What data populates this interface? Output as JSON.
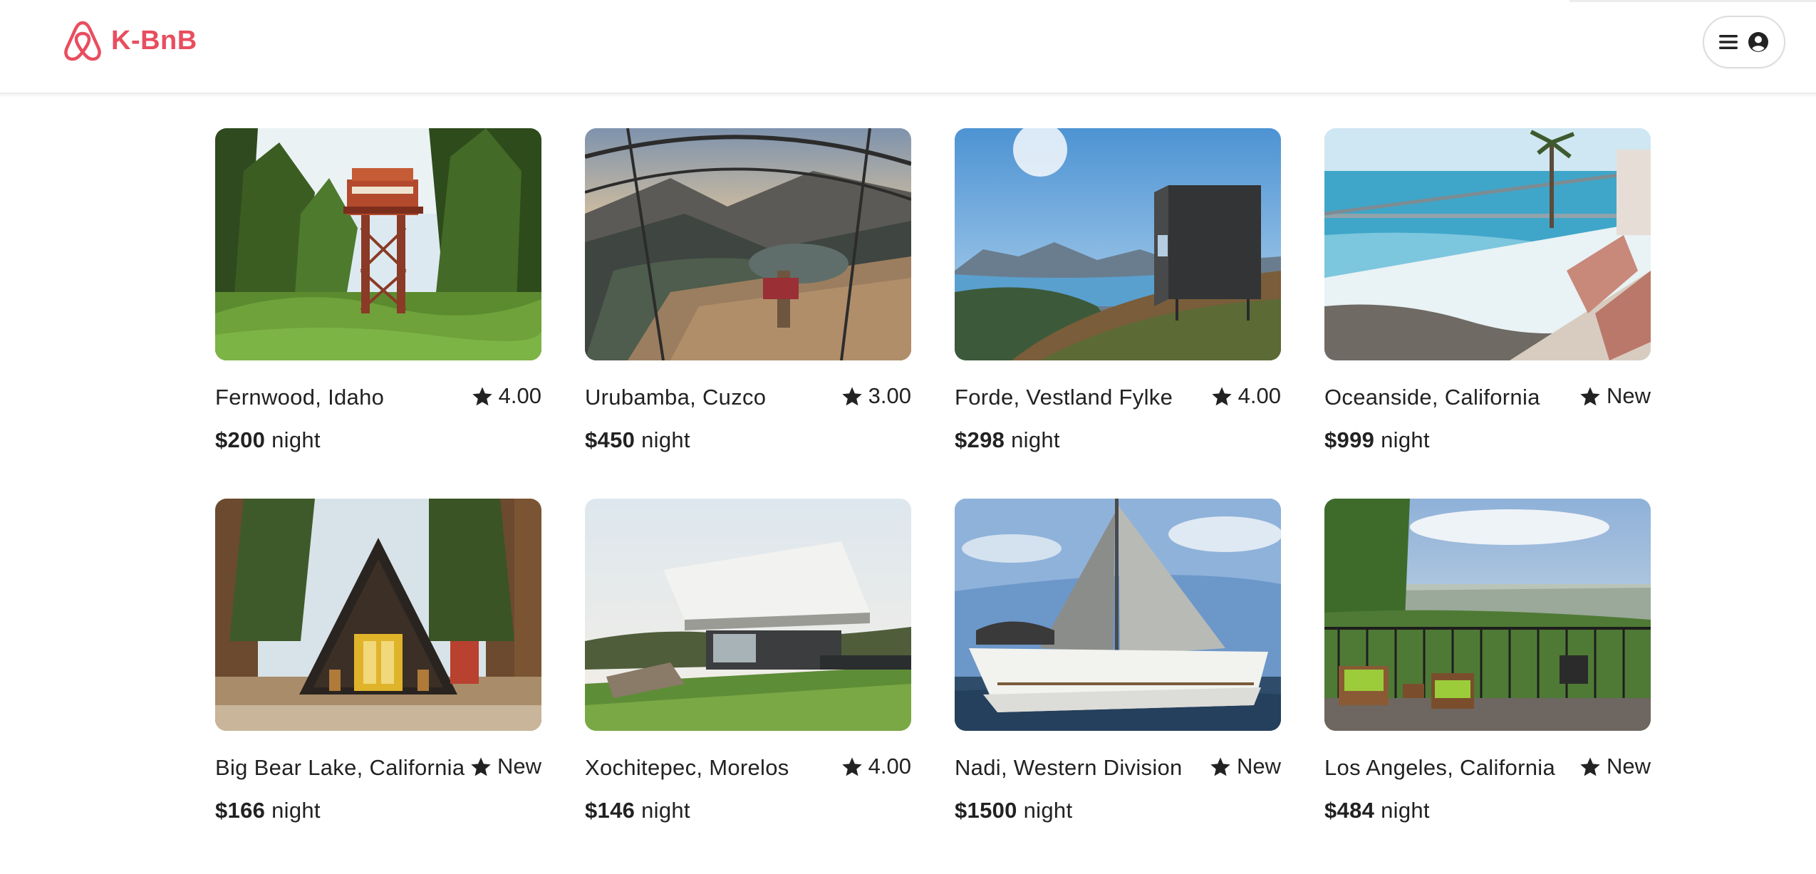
{
  "brand": {
    "name": "K-BnB",
    "color": "#e84e5f",
    "logo_icon": "airbnb-belo-icon"
  },
  "header": {
    "menu_icon": "hamburger-menu-icon",
    "avatar_icon": "user-circle-icon"
  },
  "price_suffix": "night",
  "rating_icon": "star-icon",
  "listings": [
    {
      "location": "Fernwood, Idaho",
      "rating": "4.00",
      "price": "$200",
      "image": "treehouse-fire-lookout-forest"
    },
    {
      "location": "Urubamba, Cuzco",
      "rating": "3.00",
      "price": "$450",
      "image": "glass-dome-cliff-valley"
    },
    {
      "location": "Forde, Vestland Fylke",
      "rating": "4.00",
      "price": "$298",
      "image": "black-cabin-fjord"
    },
    {
      "location": "Oceanside, California",
      "rating": "New",
      "price": "$999",
      "image": "ocean-balcony-glass-railing"
    },
    {
      "location": "Big Bear Lake, California",
      "rating": "New",
      "price": "$166",
      "image": "a-frame-cabin-pines"
    },
    {
      "location": "Xochitepec, Morelos",
      "rating": "4.00",
      "price": "$146",
      "image": "modern-cantilever-house"
    },
    {
      "location": "Nadi, Western Division",
      "rating": "New",
      "price": "$1500",
      "image": "sailboat-open-sea"
    },
    {
      "location": "Los Angeles, California",
      "rating": "New",
      "price": "$484",
      "image": "city-view-terrace"
    }
  ]
}
